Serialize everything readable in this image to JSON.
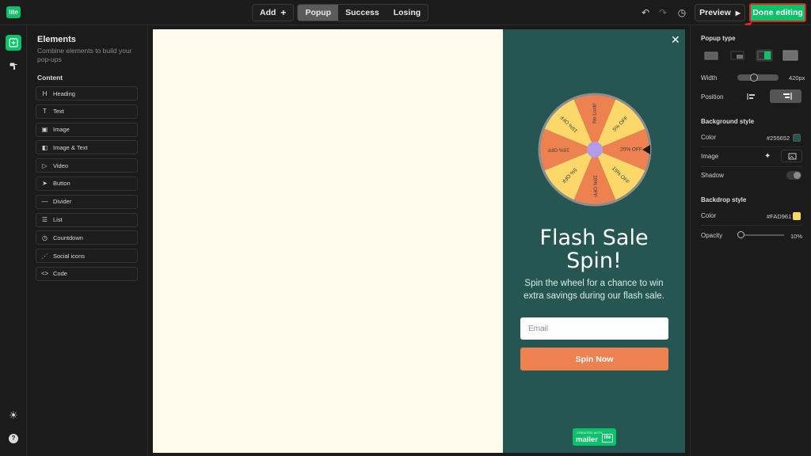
{
  "app": {
    "logo_text": "lite"
  },
  "topbar": {
    "add_label": "Add",
    "tabs": [
      {
        "label": "Popup",
        "active": true
      },
      {
        "label": "Success",
        "active": false
      },
      {
        "label": "Losing",
        "active": false
      }
    ],
    "preview_label": "Preview",
    "done_label": "Done editing"
  },
  "elements_panel": {
    "title": "Elements",
    "subtitle": "Combine elements to build your pop-ups",
    "section": "Content",
    "items": [
      {
        "label": "Heading",
        "icon": "H"
      },
      {
        "label": "Text",
        "icon": "T"
      },
      {
        "label": "Image",
        "icon": "▣"
      },
      {
        "label": "Image & Text",
        "icon": "◧"
      },
      {
        "label": "Video",
        "icon": "▷"
      },
      {
        "label": "Button",
        "icon": "➤"
      },
      {
        "label": "Divider",
        "icon": "—"
      },
      {
        "label": "List",
        "icon": "☰"
      },
      {
        "label": "Countdown",
        "icon": "◷"
      },
      {
        "label": "Social icons",
        "icon": "⋰"
      },
      {
        "label": "Code",
        "icon": "<>"
      }
    ]
  },
  "popup": {
    "headline": "Flash Sale Spin!",
    "subtext": "Spin the wheel for a chance to win extra savings during our flash sale.",
    "email_placeholder": "Email",
    "spin_label": "Spin Now",
    "badge_small": "CREATED WITH",
    "badge_big": "mailer",
    "badge_box": "lite",
    "wheel_segments": [
      "20% OFF",
      "15% OFF",
      "10% OFF",
      "5% OFF",
      "10% OFF",
      "15% OFF",
      "No Luck!",
      "5% OFF"
    ],
    "wheel_colors": {
      "orange": "#ee8150",
      "yellow": "#fcd76a",
      "hub": "#b49be8",
      "rim": "#8d8d8d"
    }
  },
  "properties": {
    "popup_type_label": "Popup type",
    "width_label": "Width",
    "width_value": "420px",
    "position_label": "Position",
    "bg_style_label": "Background style",
    "color_label": "Color",
    "bg_color_value": "#255652",
    "image_label": "Image",
    "shadow_label": "Shadow",
    "backdrop_style_label": "Backdrop style",
    "backdrop_color_label": "Color",
    "backdrop_color_value": "#FAD961",
    "opacity_label": "Opacity",
    "opacity_value": "10%"
  },
  "colors": {
    "accent": "#09c269",
    "popup_bg": "#255652",
    "canvas_bg": "#fffcee",
    "button": "#ee8150",
    "highlight": "#e02424"
  }
}
